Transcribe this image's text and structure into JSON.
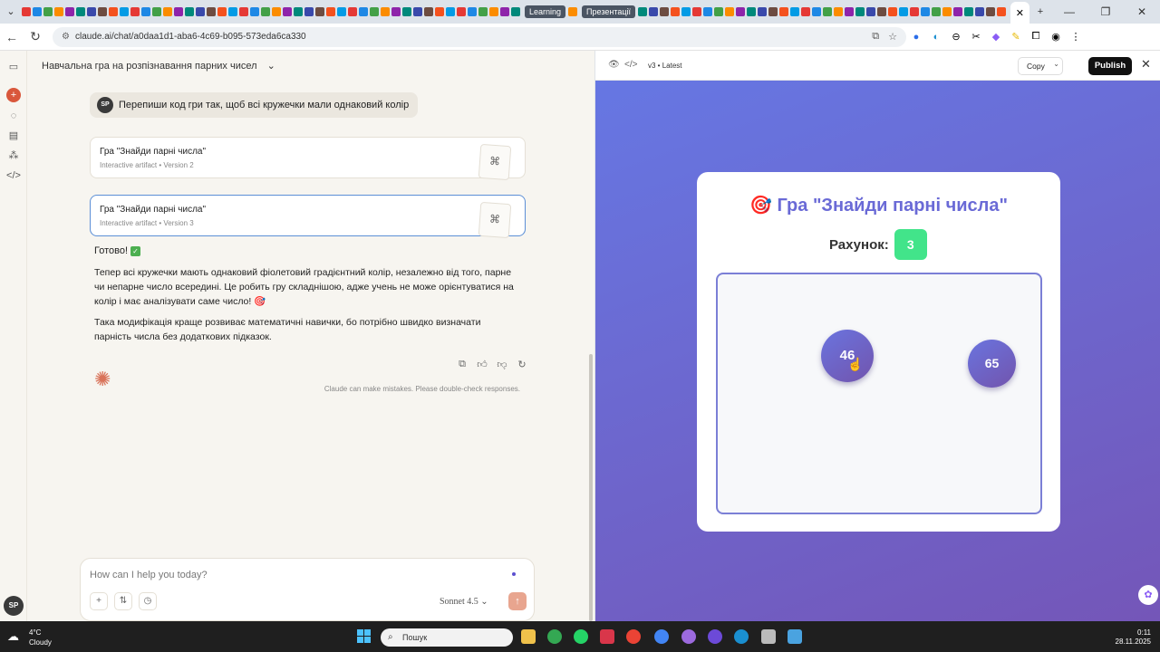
{
  "browser": {
    "tab_learning": "Learning",
    "tab_presentations": "Презентації",
    "url": "claude.ai/chat/a0daa1d1-aba6-4c69-b095-573eda6ca330"
  },
  "chat": {
    "title": "Навчальна гра на розпізнавання парних чисел",
    "user_initials": "SP",
    "user_message": "Перепиши код гри так, щоб всі кружечки мали однаковий колір",
    "artifacts": [
      {
        "title": "Гра \"Знайди парні числа\"",
        "type": "Interactive artifact",
        "version": "Version 2"
      },
      {
        "title": "Гра \"Знайди парні числа\"",
        "type": "Interactive artifact",
        "version": "Version 3"
      }
    ],
    "ready": "Готово!",
    "paragraph1": "Тепер всі кружечки мають однаковий фіолетовий градієнтний колір, незалежно від того, парне чи непарне число всередині. Це робить гру складнішою, адже учень не може орієнтуватися на колір і має аналізувати саме число! 🎯",
    "paragraph2": "Така модифікація краще розвиває математичні навички, бо потрібно швидко визначати парність числа без додаткових підказок.",
    "disclaimer": "Claude can make mistakes. Please double-check responses.",
    "input_placeholder": "How can I help you today?",
    "model": "Sonnet 4.5"
  },
  "preview": {
    "version": "v3 • Latest",
    "copy_label": "Copy",
    "publish_label": "Publish"
  },
  "game": {
    "title": "🎯 Гра \"Знайди парні числа\"",
    "score_label": "Рахунок:",
    "score_value": "3",
    "bubbles": [
      {
        "number": "46",
        "color": "#6a74df"
      },
      {
        "number": "65",
        "color": "#6a74df"
      }
    ]
  },
  "taskbar": {
    "temperature": "4°C",
    "condition": "Cloudy",
    "search_placeholder": "Пошук",
    "time": "0:11",
    "date": "28.11.2025"
  },
  "colors": {
    "score_badge": "#42e48a",
    "bubble_gradient_start": "#6a74df",
    "bubble_gradient_end": "#7254ad",
    "publish_bg": "#111111"
  }
}
